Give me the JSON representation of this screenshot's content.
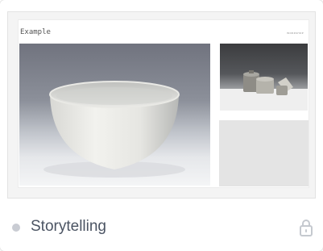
{
  "card": {
    "slide": {
      "title": "Example",
      "meta": "WORKSHOP"
    },
    "footer": {
      "title": "Storytelling"
    },
    "icons": {
      "status": "dot-indicator-icon",
      "lock": "lock-icon"
    },
    "colors": {
      "accent_text": "#4b5463",
      "dot": "#c9ccd3"
    }
  }
}
